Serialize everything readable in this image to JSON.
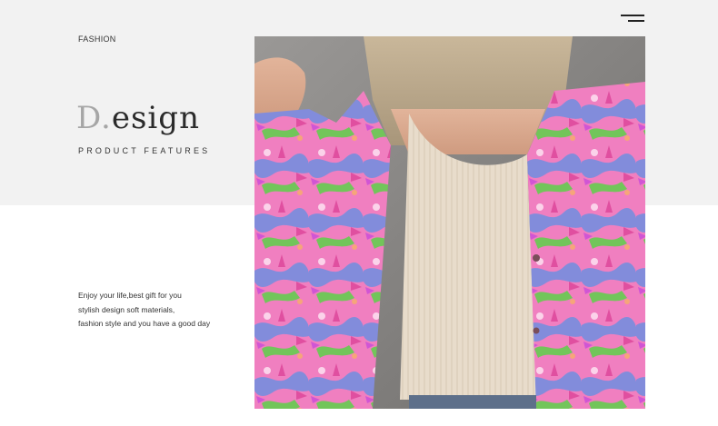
{
  "header": {
    "section_label": "FASHION"
  },
  "hero": {
    "title_initial": "D.",
    "title_rest": "esign",
    "subtitle": "PRODUCT FEATURES"
  },
  "description": {
    "lines": [
      "Enjoy your life,best gift for you",
      "stylish design soft materials,",
      "fashion style and you have a good day"
    ]
  },
  "icons": {
    "menu": "hamburger-menu-icon"
  },
  "colors": {
    "top_band": "#f2f2f2",
    "title_initial": "#a6a6a6",
    "text": "#2b2b2b",
    "print_pink": "#f07fc0",
    "print_blue": "#6f8ee0",
    "print_green": "#72c55a",
    "top_beige": "#e8dccb"
  }
}
